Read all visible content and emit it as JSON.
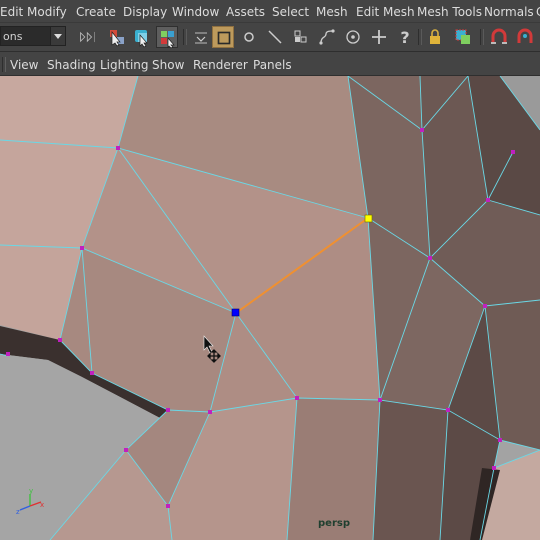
{
  "menubar": {
    "items": [
      "Edit",
      "Modify",
      "Create",
      "Display",
      "Window",
      "Assets",
      "Select",
      "Mesh",
      "Edit Mesh",
      "Mesh Tools",
      "Normals",
      "C"
    ]
  },
  "toolbar": {
    "mode_select_value": "ons",
    "tools": [
      "shelf-arrows-icon",
      "select-by-hierarchy-icon",
      "select-by-object-icon",
      "select-by-component-icon",
      "vertex-mode-icon",
      "edge-mode-icon",
      "face-mode-icon",
      "uv-mode-icon",
      "curve-icon",
      "surface-icon",
      "point-snap-icon",
      "crosshair-icon",
      "help-icon",
      "lock-icon",
      "construction-history-icon",
      "magnet-icon"
    ]
  },
  "panel_menu": {
    "items": [
      "View",
      "Shading",
      "Lighting",
      "Show",
      "Renderer",
      "Panels"
    ]
  },
  "viewport": {
    "camera_label": "persp",
    "selected_edge_color": "#f09030",
    "wire_color": "#6ad8e6",
    "vertex_color": "#c020c0",
    "selected_vertex_a_color": "#ffff00",
    "selected_vertex_b_color": "#0000ff"
  }
}
